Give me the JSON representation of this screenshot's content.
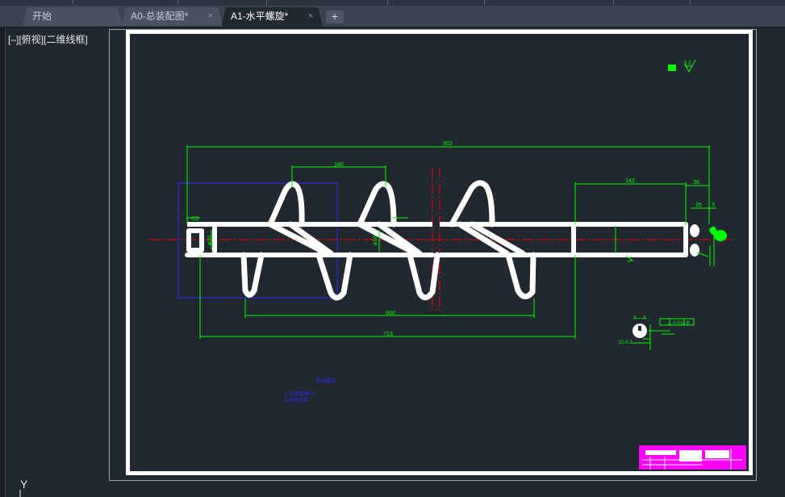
{
  "tabs": [
    {
      "label": "开始",
      "closable": false
    },
    {
      "label": "A0-总装配图*",
      "closable": true
    },
    {
      "label": "A1-水平螺旋*",
      "closable": true
    }
  ],
  "add_tab_label": "+",
  "close_glyph": "×",
  "viewport_label": "[–][俯视][二维线框]",
  "ucs_axis_label": "Y",
  "drawing": {
    "dim_overall": "902",
    "dim_pitch": "180",
    "dim_shaft_len": "142",
    "dim_38": "38",
    "dim_25": "25",
    "dim_3": "3",
    "dim_c2_left": "C2",
    "dim_c2_right": "C2",
    "dim_d20": "ø20",
    "dim_d10": "ø10",
    "dim_600": "600",
    "dim_713": "713",
    "section_label": "A—A",
    "tolerance_frame": "⊥ 0.012 B",
    "dim_12": "12-0.2",
    "roughness_mark": "3.2",
    "note_title": "技术要求",
    "note_line1": "1.未注倒角C1",
    "note_line2": "2.去除毛刺"
  },
  "colors": {
    "background": "#212830",
    "border_frame": "#ffffff",
    "dimension": "#00ff00",
    "centerline": "#ff0000",
    "annotation_blue": "#2a2aff",
    "title_block": "#ff00ff"
  }
}
